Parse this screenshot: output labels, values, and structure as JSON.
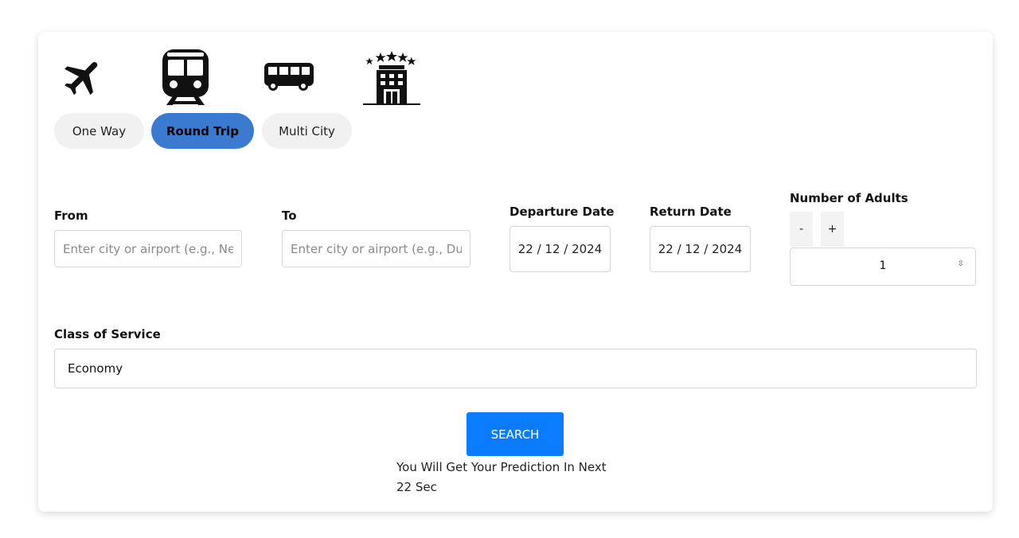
{
  "transport_modes": [
    "flight",
    "train",
    "bus",
    "hotel"
  ],
  "trip_types": [
    {
      "label": "One Way",
      "active": false
    },
    {
      "label": "Round Trip",
      "active": true
    },
    {
      "label": "Multi City",
      "active": false
    }
  ],
  "from": {
    "label": "From",
    "placeholder": "Enter city or airport (e.g., New York)"
  },
  "to": {
    "label": "To",
    "placeholder": "Enter city or airport (e.g., Dubai)"
  },
  "departure": {
    "label": "Departure Date",
    "value": "22 / 12 / 2024"
  },
  "return": {
    "label": "Return Date",
    "value": "22 / 12 / 2024"
  },
  "adults": {
    "label": "Number of Adults",
    "minus": "-",
    "plus": "+",
    "value": "1"
  },
  "class_of_service": {
    "label": "Class of Service",
    "value": "Economy"
  },
  "search": {
    "label": "SEARCH"
  },
  "prediction": {
    "line1": "You Will Get Your Prediction In Next",
    "line2": "22 Sec"
  },
  "colors": {
    "accent": "#3b7ad1",
    "search": "#0b7bff"
  }
}
